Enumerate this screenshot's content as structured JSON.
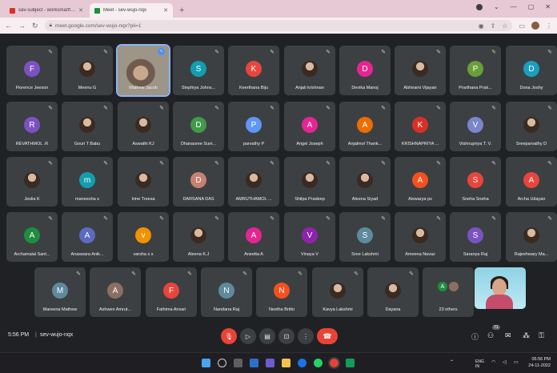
{
  "browser": {
    "tabs": [
      {
        "label": "sav-subject - worksmartfun@gm",
        "active": false,
        "favicon_color": "#d93025"
      },
      {
        "label": "Meet - sev-wujo-nqx",
        "active": true,
        "favicon_color": "#1e8e3e"
      }
    ],
    "new_tab_label": "+",
    "url": "meet.google.com/sev-wujo-nqx?pli=1",
    "window_controls": [
      "⌄",
      "—",
      "▢",
      "✕"
    ]
  },
  "participants": [
    {
      "name": "Florence Jeeson",
      "initial": "F",
      "color": "#7c52c2"
    },
    {
      "name": "Meenu G",
      "photo": true
    },
    {
      "name": "Mathew Jacob",
      "video": true,
      "speaking": true
    },
    {
      "name": "Stephiya Johns...",
      "initial": "S",
      "color": "#129eaf"
    },
    {
      "name": "Keerthana Biju",
      "initial": "K",
      "color": "#e8453c"
    },
    {
      "name": "Anjali krishnan",
      "photo": true
    },
    {
      "name": "Devika Manoj",
      "initial": "D",
      "color": "#e52592"
    },
    {
      "name": "Abhirami Vijayan",
      "photo": true
    },
    {
      "name": "Prarthana Prak...",
      "initial": "P",
      "color": "#689f38"
    },
    {
      "name": "Dona Joshy",
      "initial": "D",
      "color": "#1a9fc0"
    },
    {
      "name": "REVATHMOL .R",
      "initial": "R",
      "color": "#7c52c2"
    },
    {
      "name": "Gouri T Babu",
      "photo": true
    },
    {
      "name": "Aswathi KJ",
      "photo": true
    },
    {
      "name": "Dhanasree Suni...",
      "initial": "D",
      "color": "#3f9a4a"
    },
    {
      "name": "parvathy P",
      "initial": "P",
      "color": "#5e97f6"
    },
    {
      "name": "Angel Joseph",
      "initial": "A",
      "color": "#e52592"
    },
    {
      "name": "Anjalmol Thank...",
      "initial": "A",
      "color": "#ef6c00"
    },
    {
      "name": "KRISHNAPRIYA ...",
      "initial": "K",
      "color": "#d93025"
    },
    {
      "name": "Vishnupriya T. V.",
      "initial": "V",
      "color": "#7986cb"
    },
    {
      "name": "Sreeparvathy D",
      "photo": true
    },
    {
      "name": "Jeslia K",
      "photo": true
    },
    {
      "name": "maneesha s",
      "initial": "m",
      "color": "#129eaf"
    },
    {
      "name": "Irine Treesa",
      "photo": true
    },
    {
      "name": "DARSANA DAS",
      "initial": "D",
      "color": "#c6816f"
    },
    {
      "name": "AMRUTHAMOL ...",
      "photo": true
    },
    {
      "name": "Shilpa Pradeep",
      "photo": true
    },
    {
      "name": "Aleena Siyad",
      "photo": true
    },
    {
      "name": "Aiswarya ps",
      "initial": "A",
      "color": "#f4511e"
    },
    {
      "name": "Sneha Sneha",
      "initial": "S",
      "color": "#e8453c"
    },
    {
      "name": "Archa Udayan",
      "initial": "A",
      "color": "#e8453c"
    },
    {
      "name": "Archamalal Sant...",
      "initial": "A",
      "color": "#1e8e3e"
    },
    {
      "name": "Anaswara Anik...",
      "initial": "A",
      "color": "#5c6bc0"
    },
    {
      "name": "varsha s s",
      "initial": "v",
      "color": "#f09300"
    },
    {
      "name": "Aleena K.J",
      "photo": true
    },
    {
      "name": "Aneetta A",
      "initial": "A",
      "color": "#e52592"
    },
    {
      "name": "Vinaya V",
      "initial": "V",
      "color": "#8e24aa"
    },
    {
      "name": "Sree Lakshmi",
      "initial": "S",
      "color": "#5f8a9e"
    },
    {
      "name": "Ameena Navaz",
      "photo": true
    },
    {
      "name": "Saranya Raj",
      "initial": "S",
      "color": "#7c52c2"
    },
    {
      "name": "Rajeshwary Ma...",
      "photo": true
    },
    {
      "name": "Mareena Mathew",
      "initial": "M",
      "color": "#5f8a9e"
    },
    {
      "name": "Ashwen Amrut...",
      "initial": "A",
      "color": "#8d6e63"
    },
    {
      "name": "Fathima Ansari",
      "initial": "F",
      "color": "#e8453c"
    },
    {
      "name": "Nandana Raj",
      "initial": "N",
      "color": "#5f8a9e"
    },
    {
      "name": "Neetha Britto",
      "initial": "N",
      "color": "#f4511e"
    },
    {
      "name": "Kavya Lakshmi",
      "photo": true
    },
    {
      "name": "Dayana",
      "photo": true
    },
    {
      "name": "23 others",
      "others": true
    }
  ],
  "others_initials": [
    {
      "initial": "A",
      "color": "#1e8e3e"
    },
    {
      "initial": "",
      "color": "#8d6e63"
    }
  ],
  "meeting": {
    "time": "5:56 PM",
    "separator": "|",
    "code": "sev-wujo-nqx",
    "people_count": "71"
  },
  "icons": {
    "mic": "🎙",
    "muted": "✎"
  },
  "taskbar": {
    "lang": "ENG\nIN",
    "clock_time": "05:56 PM",
    "clock_date": "24-11-2022"
  }
}
